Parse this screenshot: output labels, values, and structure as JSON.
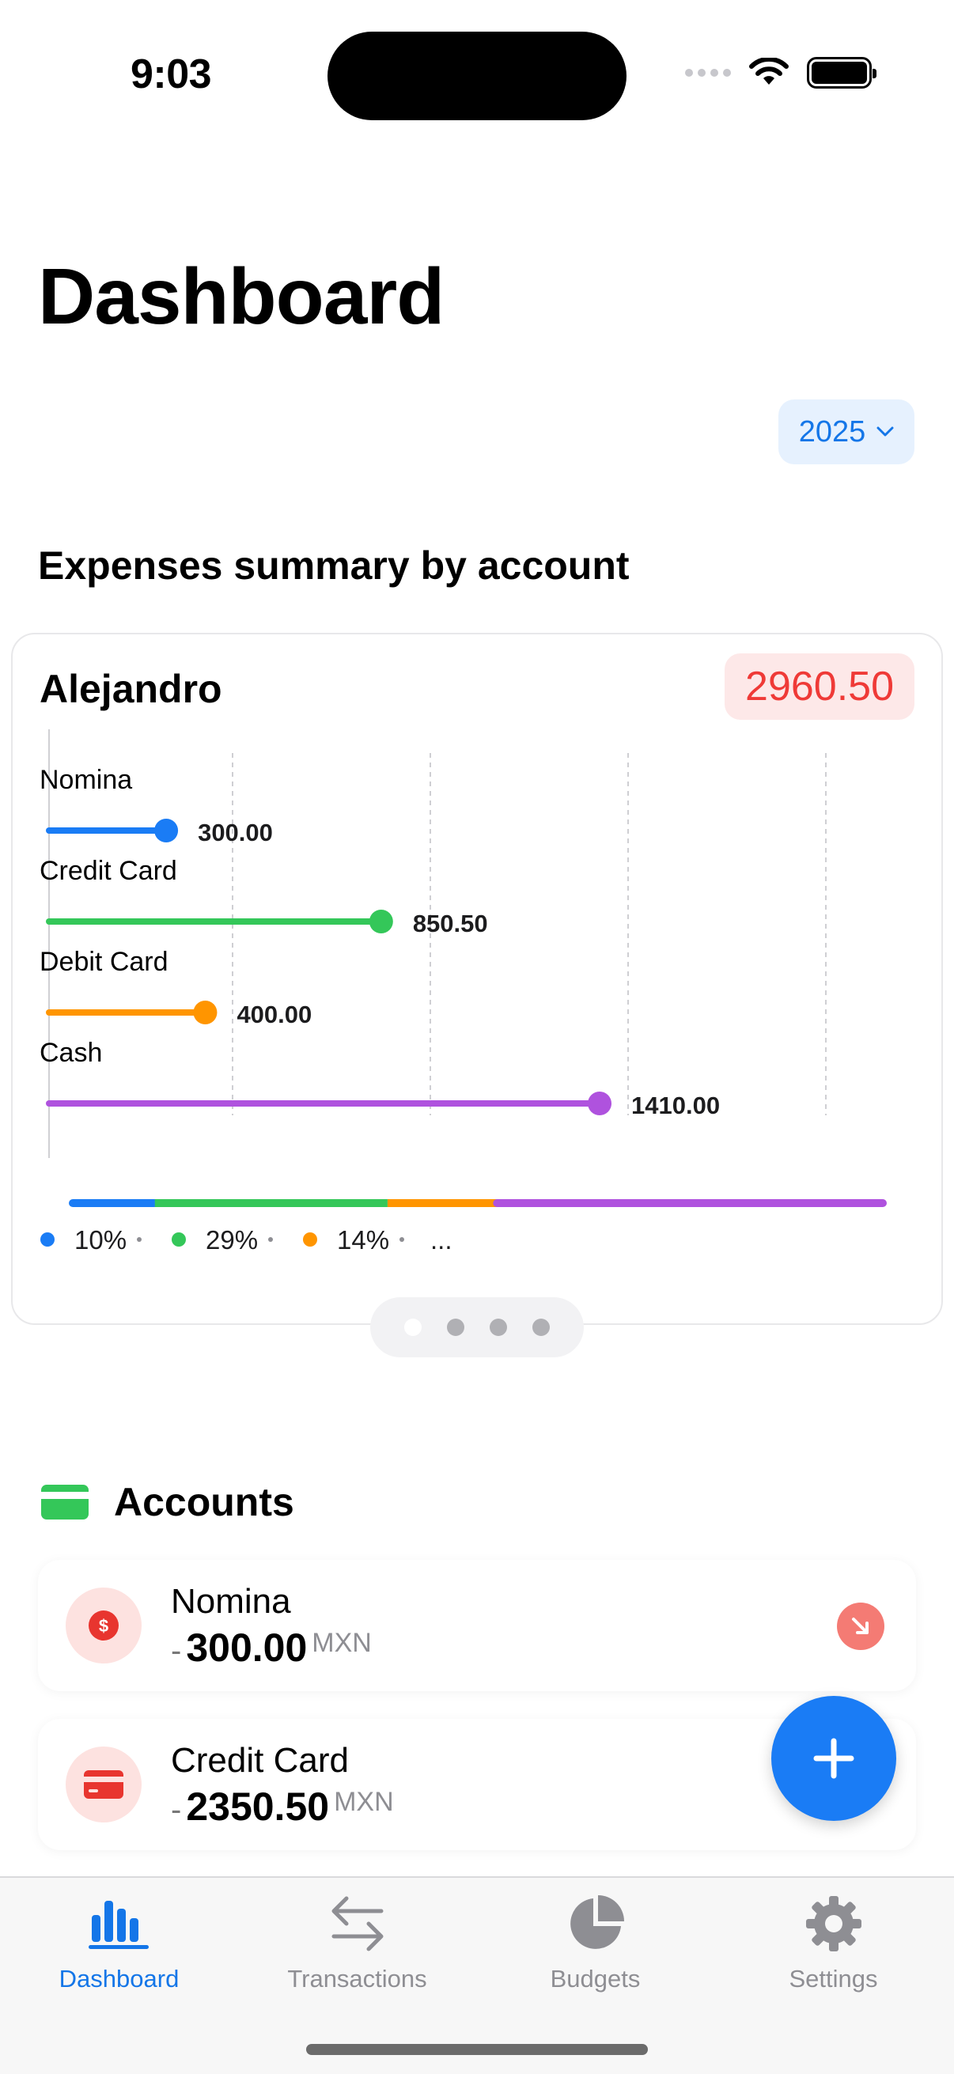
{
  "status_bar": {
    "time": "9:03"
  },
  "page": {
    "title": "Dashboard"
  },
  "year_picker": {
    "value": "2025"
  },
  "expenses_section": {
    "title": "Expenses summary by account"
  },
  "summary_card": {
    "account_holder": "Alejandro",
    "total": "2960.50",
    "total_color": "#ef3a37",
    "legend": [
      {
        "color": "#1a7cf5",
        "label": "10%"
      },
      {
        "color": "#34c759",
        "label": "29%"
      },
      {
        "color": "#ff9500",
        "label": "14%"
      }
    ],
    "legend_more": "...",
    "page_count": 4,
    "active_page": 0
  },
  "chart_data": {
    "type": "bar",
    "orientation": "horizontal",
    "style": "lollipop",
    "categories": [
      "Nomina",
      "Credit Card",
      "Debit Card",
      "Cash"
    ],
    "values": [
      300.0,
      850.5,
      400.0,
      1410.0
    ],
    "value_labels": [
      "300.00",
      "850.50",
      "400.00",
      "1410.00"
    ],
    "colors": [
      "#1a7cf5",
      "#34c759",
      "#ff9500",
      "#af52de"
    ],
    "xlim": [
      0,
      2000
    ],
    "gridlines": [
      500,
      1000,
      1500,
      2000
    ],
    "share_bar": {
      "segments": [
        {
          "label": "Nomina",
          "value": 300.0,
          "color": "#1a7cf5"
        },
        {
          "label": "Credit Card",
          "value": 850.5,
          "color": "#34c759"
        },
        {
          "label": "Debit Card",
          "value": 400.0,
          "color": "#ff9500"
        },
        {
          "label": "Cash",
          "value": 1410.0,
          "color": "#af52de"
        }
      ]
    }
  },
  "accounts": {
    "title": "Accounts",
    "items": [
      {
        "name": "Nomina",
        "sign": "-",
        "amount": "300.00",
        "currency": "MXN",
        "icon": "dollar-icon"
      },
      {
        "name": "Credit Card",
        "sign": "-",
        "amount": "2350.50",
        "currency": "MXN",
        "icon": "credit-card-icon"
      }
    ]
  },
  "tabbar": {
    "items": [
      {
        "label": "Dashboard",
        "icon": "bar-chart-icon",
        "active": true
      },
      {
        "label": "Transactions",
        "icon": "arrows-icon",
        "active": false
      },
      {
        "label": "Budgets",
        "icon": "pie-chart-icon",
        "active": false
      },
      {
        "label": "Settings",
        "icon": "gear-icon",
        "active": false
      }
    ]
  },
  "colors": {
    "accent": "#1476e8",
    "fab": "#1a7cf5",
    "negative": "#ef3a37"
  }
}
